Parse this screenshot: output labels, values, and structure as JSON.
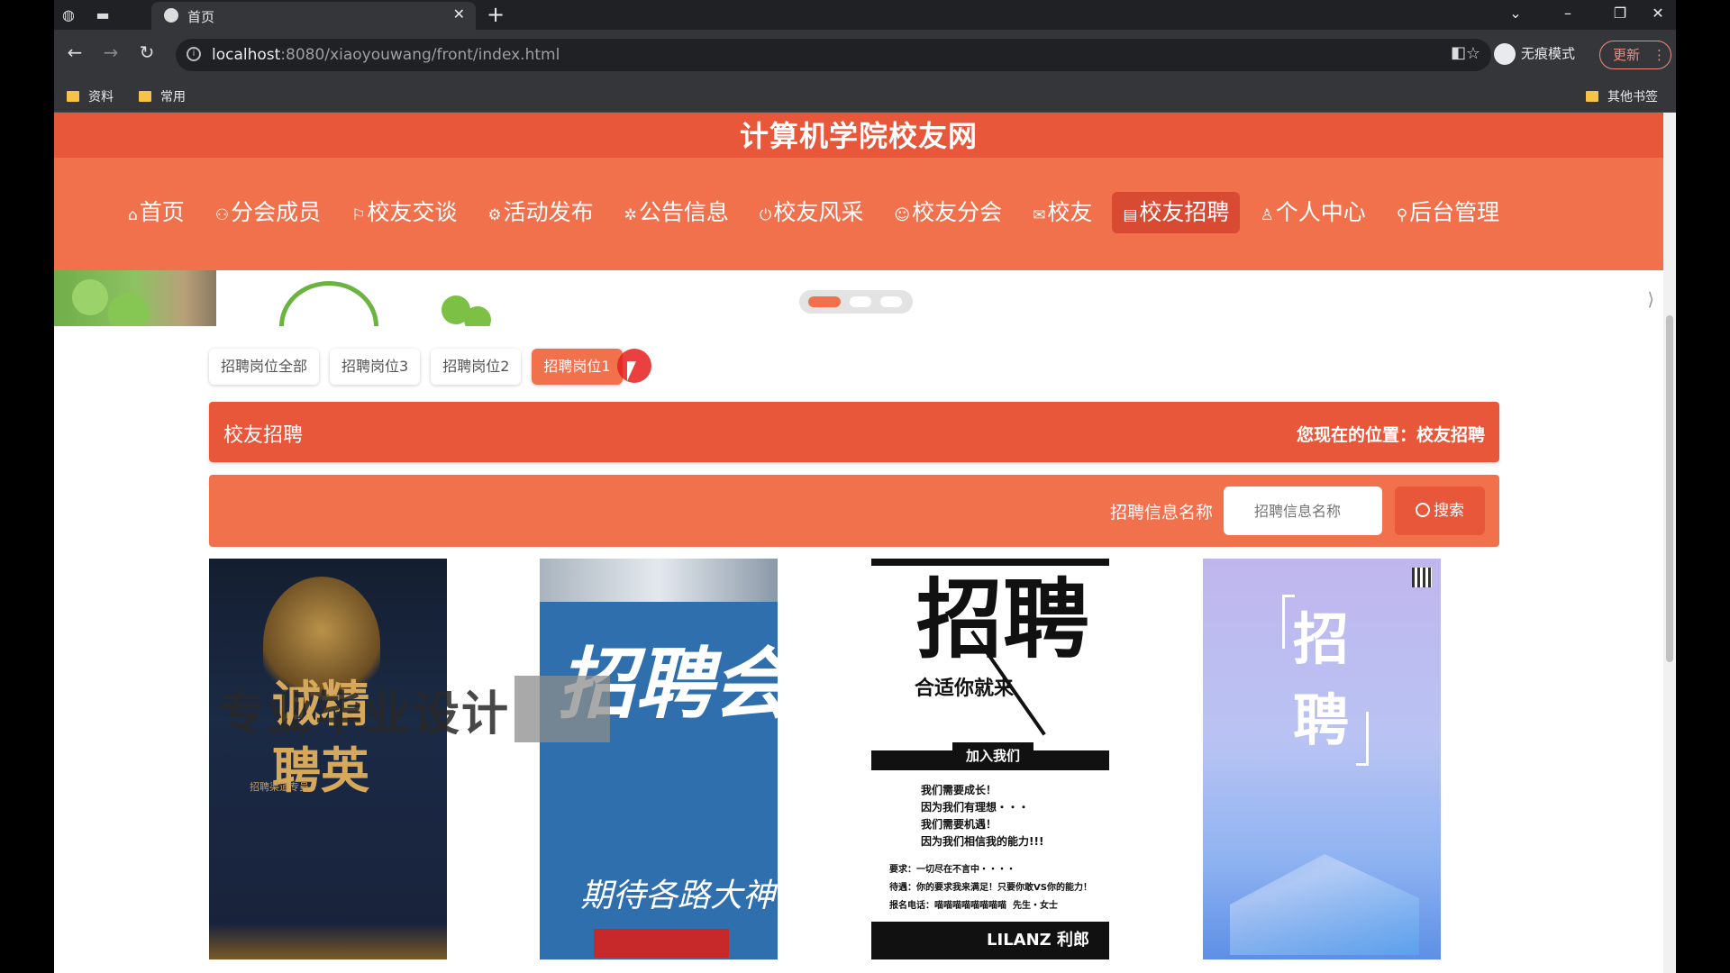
{
  "browser": {
    "tab_title": "首页",
    "url_host": "localhost",
    "url_rest": ":8080/xiaoyouwang/front/index.html",
    "incognito_label": "无痕模式",
    "update_label": "更新",
    "bookmarks": [
      "资料",
      "常用"
    ],
    "other_bookmarks": "其他书签"
  },
  "site": {
    "title": "计算机学院校友网",
    "nav": [
      {
        "icon": "⌂",
        "label": "首页"
      },
      {
        "icon": "⚇",
        "label": "分会成员"
      },
      {
        "icon": "⚐",
        "label": "校友交谈"
      },
      {
        "icon": "⚙",
        "label": "活动发布"
      },
      {
        "icon": "✲",
        "label": "公告信息"
      },
      {
        "icon": "⏻",
        "label": "校友风采"
      },
      {
        "icon": "☺",
        "label": "校友分会"
      },
      {
        "icon": "✉",
        "label": "校友"
      },
      {
        "icon": "▤",
        "label": "校友招聘"
      },
      {
        "icon": "♙",
        "label": "个人中心"
      },
      {
        "icon": "⚲",
        "label": "后台管理"
      }
    ],
    "active_nav": "校友招聘"
  },
  "subtabs": [
    "招聘岗位全部",
    "招聘岗位3",
    "招聘岗位2",
    "招聘岗位1"
  ],
  "section": {
    "title": "校友招聘",
    "location": "您现在的位置：校友招聘"
  },
  "search": {
    "label": "招聘信息名称",
    "placeholder": "招聘信息名称",
    "button": "搜索"
  },
  "cards": {
    "c1_big": "诚精\n聘英",
    "c1_small": "招聘渠道专员",
    "c2_big": "招聘会",
    "c2_sub": "期待各路大神",
    "c3_big": "招聘",
    "c3_l1": "合适你就来",
    "c3_join": "加入我们",
    "c3_body": "我们需要成长！\n因为我们有理想・・・\n我们需要机遇！\n因为我们相信我的能力!!!",
    "c3_req": "要求：一切尽在不言中・・・・\n待遇：你的要求我来满足！只要你敢VS你的能力！\n报名电话：喵喵喵喵喵喵喵喵  先生・女士",
    "c3_brand": "LILANZ 利郎",
    "c4_big": "招\n聘"
  },
  "overlay": {
    "watermark": "专业毕业设计"
  },
  "colors": {
    "header": "#f0714c",
    "title_bar": "#e8573a",
    "active": "#d84a31"
  }
}
